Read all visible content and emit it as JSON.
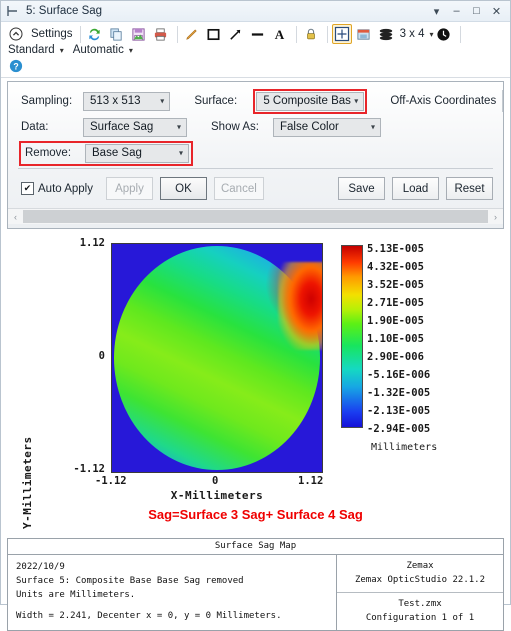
{
  "window": {
    "title": "5: Surface Sag",
    "title_icon": "window-pin-icon",
    "buttons": {
      "dropdown": "▾",
      "minimize": "–",
      "maximize": "□",
      "close": "✕"
    }
  },
  "toolbar": {
    "settings_label": "Settings",
    "grid_label": "3 x 4",
    "grid_caret": "▾",
    "style_menu": "Standard",
    "style_caret": "▾",
    "scale_menu": "Automatic",
    "scale_caret": "▾",
    "icons": [
      "settings-chevron-icon",
      "refresh-icon",
      "copy-icon",
      "save-image-icon",
      "print-icon",
      "pencil-icon",
      "rectangle-icon",
      "arrow-icon",
      "line-icon",
      "text-icon",
      "lock-icon",
      "crosshair-icon",
      "image-export-icon",
      "layers-icon",
      "clock-icon",
      "help-icon"
    ]
  },
  "settings": {
    "sampling": {
      "label": "Sampling:",
      "value": "513 x 513"
    },
    "data": {
      "label": "Data:",
      "value": "Surface Sag"
    },
    "remove": {
      "label": "Remove:",
      "value": "Base Sag",
      "highlighted": true
    },
    "surface": {
      "label": "Surface:",
      "value": "5 Composite Bas",
      "highlighted": true
    },
    "show_as": {
      "label": "Show As:",
      "value": "False Color"
    },
    "off_axis": "Off-Axis Coordinates",
    "auto_apply": {
      "label": "Auto Apply",
      "checked": true,
      "mark": "✔"
    },
    "apply": "Apply",
    "ok": "OK",
    "cancel": "Cancel",
    "save": "Save",
    "load": "Load",
    "reset": "Reset",
    "highlight_color": "#e8252a"
  },
  "chart_data": {
    "type": "heatmap",
    "title": "Surface Sag Map",
    "xlabel": "X-Millimeters",
    "ylabel": "Y-Millimeters",
    "xticks": [
      "-1.12",
      "0",
      "1.12"
    ],
    "yticks": [
      "1.12",
      "0",
      "-1.12"
    ],
    "xlim": [
      -1.12,
      1.12
    ],
    "ylim": [
      -1.12,
      1.12
    ],
    "annotation": "Sag=Surface 3 Sag+ Surface 4 Sag",
    "annotation_color": "#ef0000",
    "colorbar": {
      "units": "Millimeters",
      "labels": [
        "5.13E-005",
        "4.32E-005",
        "3.52E-005",
        "2.71E-005",
        "1.90E-005",
        "1.10E-005",
        "2.90E-006",
        "-5.16E-006",
        "-1.32E-005",
        "-2.13E-005",
        "-2.94E-005"
      ],
      "min": -2.94e-05,
      "max": 5.13e-05,
      "colormap": "jet"
    },
    "background_color": "#2718d8",
    "description": "Circular pupil false-color sag map; diagonal green/yellow band from lower-left to upper-right with a red hot spot on the upper-right rim and blue regions at upper-left and lower-right edges."
  },
  "footer": {
    "header": "Surface Sag Map",
    "left_lines": [
      "2022/10/9",
      "Surface 5: Composite Base Base Sag removed",
      "Units are Millimeters.",
      "",
      "Width = 2.241, Decenter x = 0, y = 0 Millimeters."
    ],
    "right_cells": [
      [
        "Zemax",
        "Zemax OpticStudio 22.1.2"
      ],
      [
        "Test.zmx",
        "Configuration 1 of 1"
      ]
    ]
  }
}
